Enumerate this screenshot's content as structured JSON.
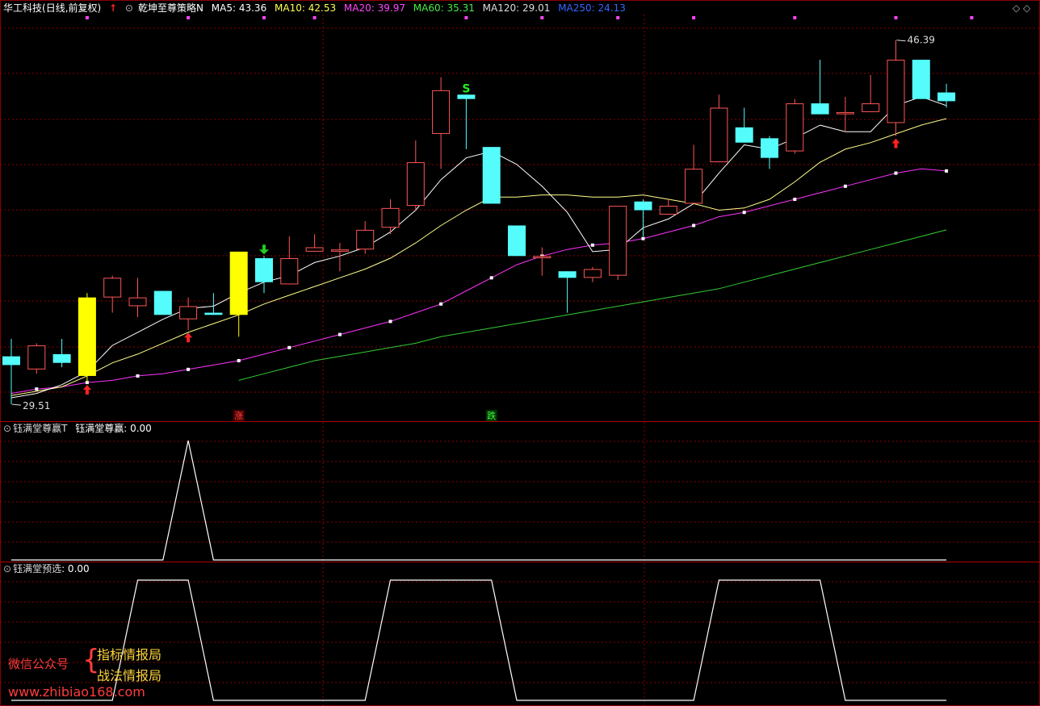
{
  "header": {
    "stock": "华工科技",
    "period": "(日线,前复权)",
    "indicator": "乾坤至尊策略N",
    "ma_labels": [
      {
        "text": "MA5: 43.36",
        "color": "#ffffff"
      },
      {
        "text": "MA10: 42.53",
        "color": "#ffff55"
      },
      {
        "text": "MA20: 39.97",
        "color": "#ff44ff"
      },
      {
        "text": "MA60: 35.31",
        "color": "#44ee44"
      },
      {
        "text": "MA120: 29.01",
        "color": "#dddddd"
      },
      {
        "text": "MA250: 24.13",
        "color": "#3366ff"
      }
    ]
  },
  "panel2_header": {
    "name": "钰满堂尊赢T",
    "value_text": "钰满堂尊赢: 0.00"
  },
  "panel3_header": {
    "name": "钰满堂预选",
    "value_text": ": 0.00"
  },
  "colors": {
    "up": "#ff5555",
    "down": "#54fcfc",
    "special": "#ffff00",
    "grid": "#8b0000",
    "ma5": "#ffffff",
    "ma10": "#ffff88",
    "ma20": "#ff33ff",
    "ma60": "#33cc33"
  },
  "chart_data": [
    {
      "type": "candlestick",
      "title": "",
      "price_labels": {
        "high": "46.39",
        "low": "29.51"
      },
      "ylim": [
        29,
        47.5
      ],
      "candles": [
        {
          "o": 31.9,
          "c": 31.5,
          "h": 32.7,
          "l": 29.7,
          "k": "down"
        },
        {
          "o": 31.3,
          "c": 32.4,
          "h": 32.5,
          "l": 31.1,
          "k": "up"
        },
        {
          "o": 32.0,
          "c": 31.6,
          "h": 32.7,
          "l": 31.4,
          "k": "down"
        },
        {
          "o": 31.0,
          "c": 34.6,
          "h": 34.8,
          "l": 30.7,
          "k": "special"
        },
        {
          "o": 34.6,
          "c": 35.5,
          "h": 35.6,
          "l": 33.9,
          "k": "up"
        },
        {
          "o": 34.2,
          "c": 34.6,
          "h": 35.5,
          "l": 33.7,
          "k": "up"
        },
        {
          "o": 34.9,
          "c": 33.8,
          "h": 34.9,
          "l": 33.8,
          "k": "down"
        },
        {
          "o": 33.6,
          "c": 34.2,
          "h": 34.6,
          "l": 33.1,
          "k": "up"
        },
        {
          "o": 33.9,
          "c": 33.8,
          "h": 34.8,
          "l": 33.8,
          "k": "down"
        },
        {
          "o": 33.8,
          "c": 36.7,
          "h": 36.7,
          "l": 32.8,
          "k": "special"
        },
        {
          "o": 36.4,
          "c": 35.3,
          "h": 36.5,
          "l": 34.8,
          "k": "down"
        },
        {
          "o": 35.2,
          "c": 36.4,
          "h": 37.4,
          "l": 35.2,
          "k": "up"
        },
        {
          "o": 36.7,
          "c": 36.9,
          "h": 37.5,
          "l": 36.7,
          "k": "up"
        },
        {
          "o": 36.7,
          "c": 36.8,
          "h": 37.1,
          "l": 35.8,
          "k": "up"
        },
        {
          "o": 36.8,
          "c": 37.7,
          "h": 38.1,
          "l": 36.6,
          "k": "up"
        },
        {
          "o": 37.8,
          "c": 38.7,
          "h": 39.1,
          "l": 37.5,
          "k": "up"
        },
        {
          "o": 38.8,
          "c": 40.8,
          "h": 41.8,
          "l": 38.6,
          "k": "up"
        },
        {
          "o": 42.1,
          "c": 44.1,
          "h": 44.7,
          "l": 40.5,
          "k": "up"
        },
        {
          "o": 43.9,
          "c": 43.7,
          "h": 43.9,
          "l": 41.4,
          "k": "down"
        },
        {
          "o": 41.5,
          "c": 38.9,
          "h": 41.5,
          "l": 38.9,
          "k": "down"
        },
        {
          "o": 37.9,
          "c": 36.5,
          "h": 37.9,
          "l": 36.5,
          "k": "down"
        },
        {
          "o": 36.4,
          "c": 36.5,
          "h": 36.9,
          "l": 35.6,
          "k": "up"
        },
        {
          "o": 35.8,
          "c": 35.5,
          "h": 35.8,
          "l": 33.9,
          "k": "down"
        },
        {
          "o": 35.5,
          "c": 35.9,
          "h": 36.0,
          "l": 35.3,
          "k": "up"
        },
        {
          "o": 35.6,
          "c": 38.8,
          "h": 38.8,
          "l": 35.4,
          "k": "up"
        },
        {
          "o": 39.0,
          "c": 38.6,
          "h": 39.1,
          "l": 37.4,
          "k": "down"
        },
        {
          "o": 38.4,
          "c": 38.8,
          "h": 39.1,
          "l": 38.4,
          "k": "up"
        },
        {
          "o": 38.9,
          "c": 40.5,
          "h": 41.6,
          "l": 38.9,
          "k": "up"
        },
        {
          "o": 40.8,
          "c": 43.3,
          "h": 43.9,
          "l": 40.8,
          "k": "up"
        },
        {
          "o": 42.4,
          "c": 41.7,
          "h": 43.3,
          "l": 41.7,
          "k": "down"
        },
        {
          "o": 41.9,
          "c": 41.0,
          "h": 42.0,
          "l": 40.5,
          "k": "down"
        },
        {
          "o": 41.3,
          "c": 43.5,
          "h": 43.7,
          "l": 41.2,
          "k": "up"
        },
        {
          "o": 43.5,
          "c": 43.0,
          "h": 45.5,
          "l": 43.0,
          "k": "down"
        },
        {
          "o": 43.0,
          "c": 43.1,
          "h": 43.8,
          "l": 42.2,
          "k": "up"
        },
        {
          "o": 43.1,
          "c": 43.5,
          "h": 44.8,
          "l": 43.1,
          "k": "up"
        },
        {
          "o": 42.6,
          "c": 45.5,
          "h": 46.4,
          "l": 42.0,
          "k": "up"
        },
        {
          "o": 45.5,
          "c": 43.7,
          "h": 45.5,
          "l": 43.7,
          "k": "down"
        },
        {
          "o": 44.0,
          "c": 43.6,
          "h": 44.4,
          "l": 43.3,
          "k": "down"
        }
      ],
      "ma5": [
        30.0,
        30.2,
        30.6,
        31.2,
        32.4,
        33.0,
        33.6,
        34.1,
        34.2,
        34.8,
        35.3,
        35.6,
        36.2,
        36.5,
        36.9,
        37.6,
        38.6,
        40.0,
        41.0,
        41.3,
        40.7,
        39.7,
        38.5,
        36.7,
        36.8,
        37.8,
        38.2,
        38.9,
        40.3,
        41.6,
        41.4,
        41.9,
        42.5,
        42.2,
        42.2,
        43.4,
        43.8,
        43.4
      ],
      "ma10": [
        30.1,
        30.3,
        30.5,
        31.0,
        31.6,
        32.0,
        32.5,
        33.0,
        33.4,
        33.8,
        34.3,
        34.7,
        35.1,
        35.5,
        35.9,
        36.4,
        37.1,
        37.9,
        38.6,
        39.2,
        39.2,
        39.3,
        39.3,
        39.2,
        39.2,
        39.3,
        39.1,
        38.9,
        38.6,
        38.7,
        39.1,
        39.9,
        40.8,
        41.4,
        41.7,
        42.1,
        42.5,
        42.8
      ],
      "ma20": [
        30.2,
        30.4,
        30.5,
        30.7,
        30.8,
        31.0,
        31.1,
        31.3,
        31.5,
        31.7,
        32.0,
        32.3,
        32.6,
        32.9,
        33.2,
        33.5,
        33.9,
        34.3,
        34.9,
        35.5,
        36.1,
        36.5,
        36.8,
        37.0,
        37.1,
        37.3,
        37.6,
        37.9,
        38.3,
        38.5,
        38.8,
        39.1,
        39.4,
        39.7,
        40.0,
        40.3,
        40.5,
        40.4
      ],
      "ma60": [
        28.8,
        29.0,
        29.2,
        29.4,
        29.6,
        29.8,
        30.0,
        30.2,
        30.5,
        30.8,
        31.1,
        31.4,
        31.7,
        31.9,
        32.1,
        32.3,
        32.5,
        32.8,
        33.0,
        33.2,
        33.4,
        33.6,
        33.8,
        34.0,
        34.2,
        34.4,
        34.6,
        34.8,
        35.0,
        35.3,
        35.6,
        35.9,
        36.2,
        36.5,
        36.8,
        37.1,
        37.4,
        37.7
      ],
      "markers": [
        {
          "i": 3,
          "type": "up-arrow"
        },
        {
          "i": 7,
          "type": "up-arrow"
        },
        {
          "i": 10,
          "type": "down-arrow"
        },
        {
          "i": 18,
          "type": "S"
        },
        {
          "i": 35,
          "type": "up-arrow"
        }
      ],
      "labels": [
        {
          "i": 9,
          "text": "涨",
          "color": "#ff4444"
        },
        {
          "i": 19,
          "text": "跌",
          "color": "#44ff44"
        }
      ]
    },
    {
      "type": "line",
      "title": "钰满堂尊赢",
      "ylim": [
        0,
        1
      ],
      "values": [
        0,
        0,
        0,
        0,
        0,
        0,
        0,
        1,
        0,
        0,
        0,
        0,
        0,
        0,
        0,
        0,
        0,
        0,
        0,
        0,
        0,
        0,
        0,
        0,
        0,
        0,
        0,
        0,
        0,
        0,
        0,
        0,
        0,
        0,
        0,
        0,
        0,
        0
      ]
    },
    {
      "type": "line",
      "title": "钰满堂预选",
      "ylim": [
        0,
        1
      ],
      "values": [
        0,
        0,
        0,
        0,
        0,
        1,
        1,
        1,
        0,
        0,
        0,
        0,
        0,
        0,
        0,
        1,
        1,
        1,
        1,
        1,
        0,
        0,
        0,
        0,
        0,
        0,
        0,
        0,
        1,
        1,
        1,
        1,
        1,
        0,
        0,
        0,
        0,
        0
      ]
    }
  ],
  "watermark": {
    "label": "微信公众号",
    "brace": "{",
    "line1": "指标情报局",
    "line2": "战法情报局",
    "url": "www.zhibiao168.com"
  }
}
